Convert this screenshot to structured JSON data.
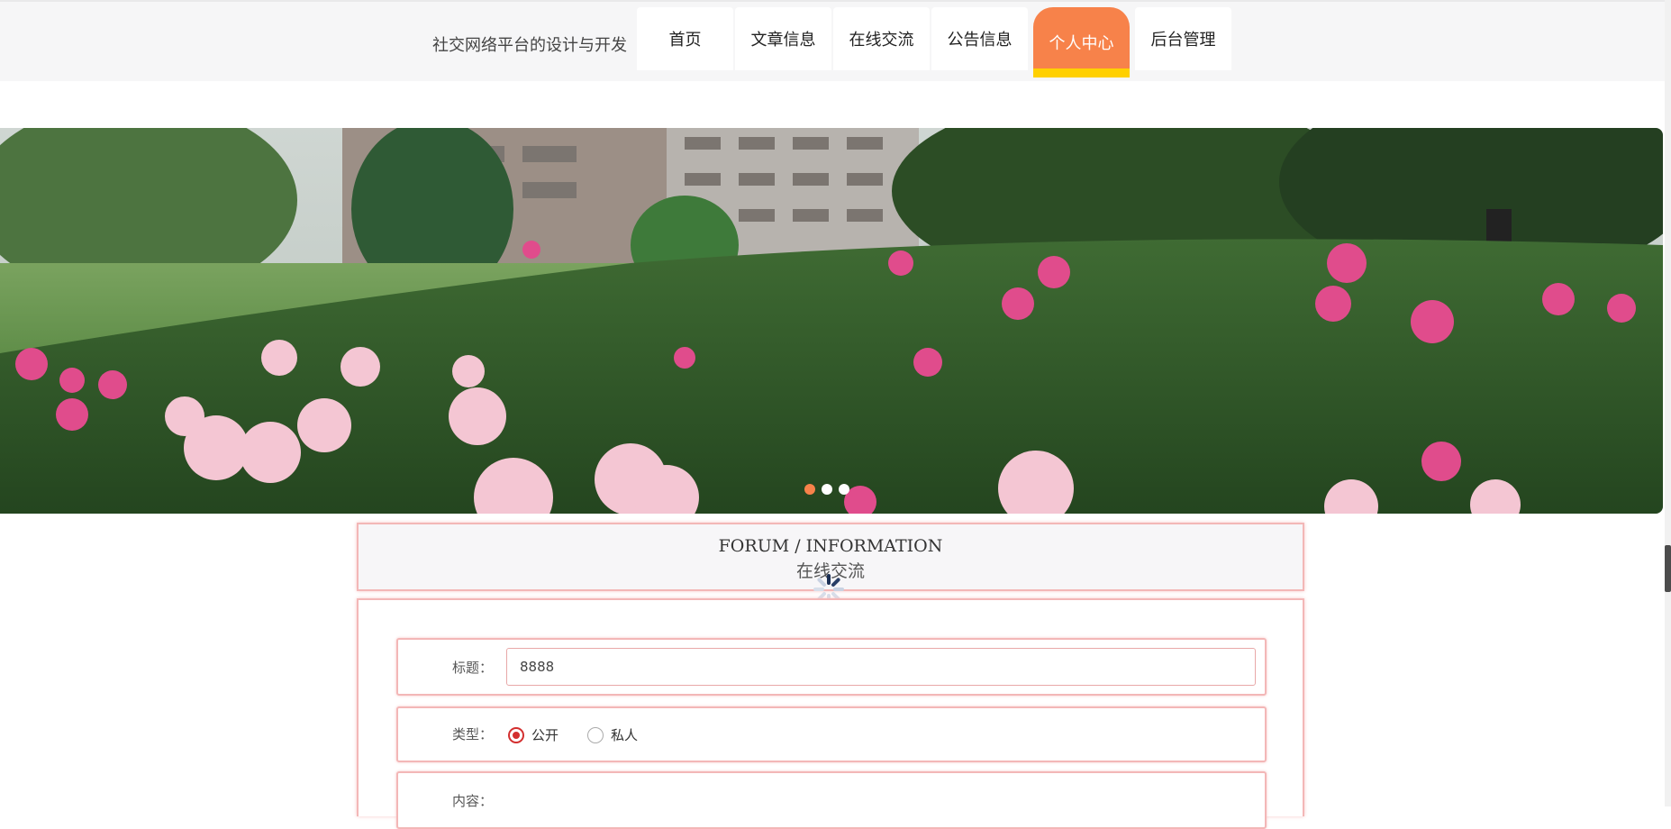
{
  "header": {
    "site_title": "社交网络平台的设计与开发",
    "nav": [
      {
        "label": "首页",
        "active": false
      },
      {
        "label": "文章信息",
        "active": false
      },
      {
        "label": "在线交流",
        "active": false
      },
      {
        "label": "公告信息",
        "active": false
      },
      {
        "label": "个人中心",
        "active": true
      },
      {
        "label": "后台管理",
        "active": false
      }
    ]
  },
  "carousel": {
    "slide_count": 3,
    "active_index": 0
  },
  "section": {
    "title_en": "FORUM / INFORMATION",
    "title_cn": "在线交流"
  },
  "form": {
    "title_label": "标题：",
    "title_value": "8888",
    "type_label": "类型：",
    "type_options": [
      "公开",
      "私人"
    ],
    "type_selected": "公开",
    "content_label": "内容："
  },
  "colors": {
    "accent": "#f7824a",
    "accent_underline": "#ffd000",
    "panel_border": "#f3b7b7",
    "radio_checked": "#d32f2f"
  }
}
